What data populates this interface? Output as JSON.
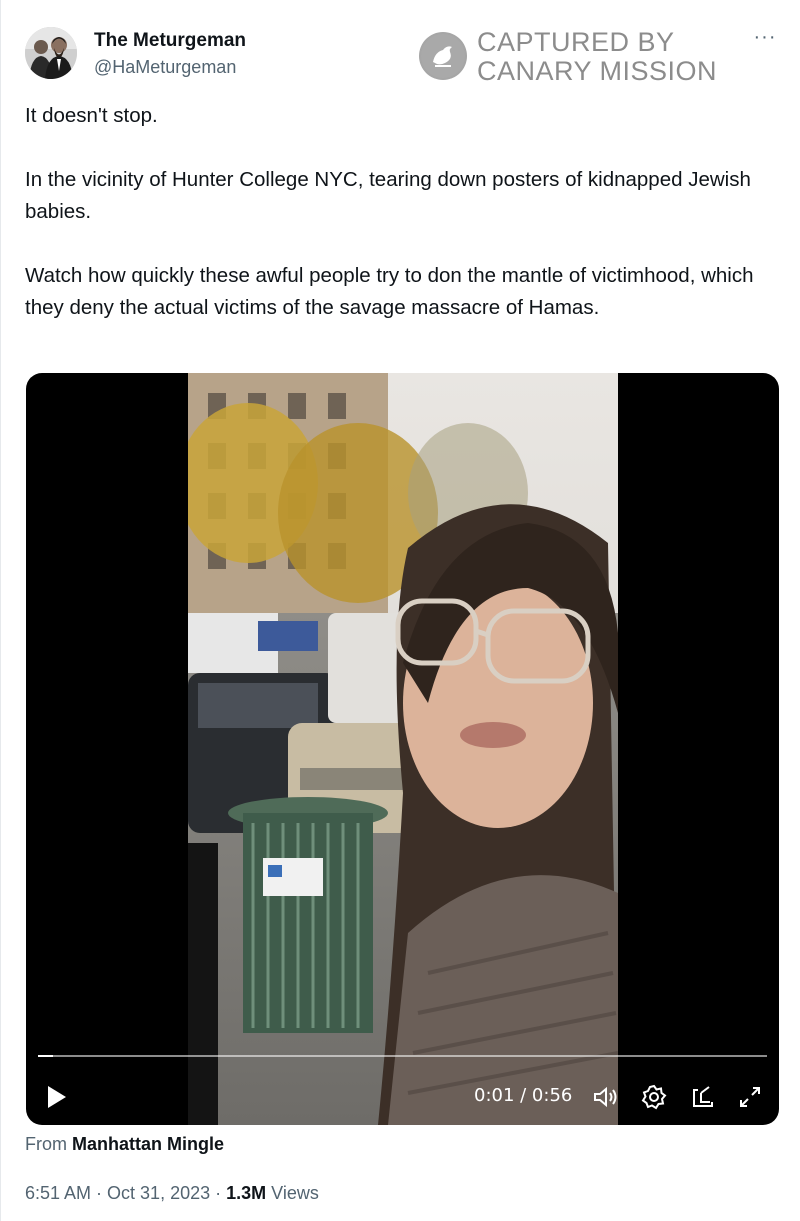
{
  "author": {
    "name": "The Meturgeman",
    "handle": "@HaMeturgeman"
  },
  "watermark": {
    "line1": "CAPTURED BY",
    "line2": "CANARY MISSION"
  },
  "more_label": "···",
  "tweet": {
    "paragraphs": [
      "It doesn't stop.",
      "In the vicinity of Hunter College NYC, tearing down posters of kidnapped Jewish babies.",
      "Watch how quickly these awful people try to don the mantle of victimhood, which they deny the actual victims of the savage massacre of Hamas."
    ]
  },
  "video": {
    "time": "0:01 / 0:56",
    "progress": 0.02,
    "icons": [
      "play-icon",
      "volume-icon",
      "settings-icon",
      "picture-in-picture-icon",
      "fullscreen-icon"
    ]
  },
  "source": {
    "prefix": "From",
    "name": "Manhattan Mingle"
  },
  "meta": {
    "time": "6:51 AM",
    "sep1": " · ",
    "date": "Oct 31, 2023",
    "sep2": " · ",
    "views_count": "1.3M",
    "views_label": "Views"
  },
  "colors": {
    "text": "#0f1419",
    "secondary": "#536471",
    "watermark": "#8c8c8c",
    "video_bg": "#000000"
  }
}
